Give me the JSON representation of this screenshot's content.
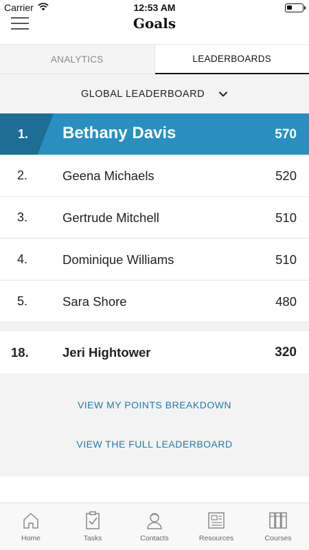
{
  "status_bar": {
    "carrier": "Carrier",
    "time": "12:53 AM"
  },
  "nav": {
    "title": "Goals"
  },
  "tabs": [
    {
      "label": "ANALYTICS",
      "active": false
    },
    {
      "label": "LEADERBOARDS",
      "active": true
    }
  ],
  "leaderboard": {
    "selector_label": "GLOBAL LEADERBOARD",
    "rows": [
      {
        "rank": "1.",
        "name": "Bethany Davis",
        "points": "570"
      },
      {
        "rank": "2.",
        "name": "Geena Michaels",
        "points": "520"
      },
      {
        "rank": "3.",
        "name": "Gertrude Mitchell",
        "points": "510"
      },
      {
        "rank": "4.",
        "name": "Dominique Williams",
        "points": "510"
      },
      {
        "rank": "5.",
        "name": "Sara Shore",
        "points": "480"
      }
    ],
    "current_user": {
      "rank": "18.",
      "name": "Jeri Hightower",
      "points": "320"
    },
    "links": {
      "points_breakdown": "VIEW MY POINTS BREAKDOWN",
      "full_leaderboard": "VIEW THE FULL LEADERBOARD"
    }
  },
  "tab_bar": [
    {
      "label": "Home",
      "icon": "home-icon"
    },
    {
      "label": "Tasks",
      "icon": "tasks-icon"
    },
    {
      "label": "Contacts",
      "icon": "contacts-icon"
    },
    {
      "label": "Resources",
      "icon": "resources-icon"
    },
    {
      "label": "Courses",
      "icon": "courses-icon"
    }
  ],
  "colors": {
    "accent": "#2a8fc0",
    "accent_dark": "#1d6d94",
    "link": "#2279a8",
    "background": "#f3f3f3"
  }
}
